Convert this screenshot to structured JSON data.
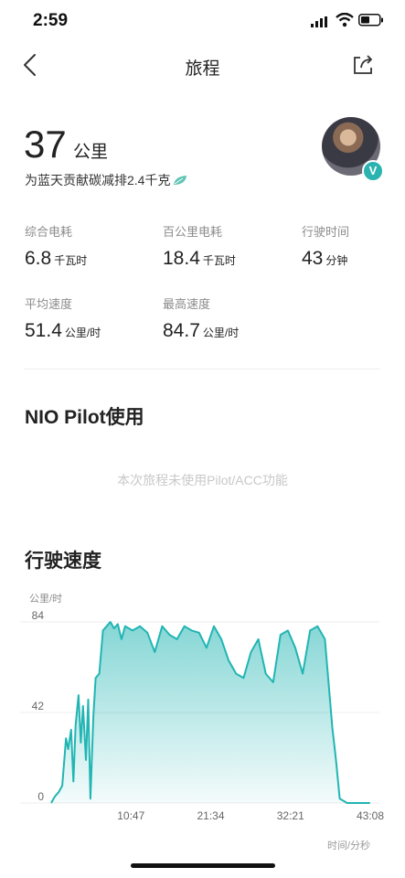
{
  "status_bar": {
    "time": "2:59"
  },
  "header": {
    "title": "旅程"
  },
  "summary": {
    "distance_value": "37",
    "distance_unit": "公里",
    "carbon_text": "为蓝天贡献碳减排2.4千克"
  },
  "stats": [
    {
      "label": "综合电耗",
      "value": "6.8",
      "unit": "千瓦时"
    },
    {
      "label": "百公里电耗",
      "value": "18.4",
      "unit": "千瓦时"
    },
    {
      "label": "行驶时间",
      "value": "43",
      "unit": "分钟"
    },
    {
      "label": "平均速度",
      "value": "51.4",
      "unit": "公里/时"
    },
    {
      "label": "最高速度",
      "value": "84.7",
      "unit": "公里/时"
    }
  ],
  "pilot": {
    "title": "NIO Pilot使用",
    "note": "本次旅程未使用Pilot/ACC功能"
  },
  "speed_section": {
    "title": "行驶速度"
  },
  "colors": {
    "accent": "#21b5b3",
    "badge": "#2bb3b0",
    "leaf": "#5ec4b4"
  },
  "icons": [
    "back-icon",
    "share-icon",
    "leaf-icon",
    "verified-badge-icon"
  ],
  "chart_data": {
    "type": "area",
    "title": "行驶速度",
    "ylabel": "公里/时",
    "xlabel": "时间/分秒",
    "ylim": [
      0,
      84
    ],
    "yticks": [
      "0",
      "42",
      "84"
    ],
    "xticks": [
      "10:47",
      "21:34",
      "32:21",
      "43:08"
    ],
    "x_minutes": [
      0,
      0.5,
      1,
      1.5,
      2,
      2.3,
      2.7,
      3,
      3.3,
      3.7,
      4,
      4.3,
      4.7,
      5,
      5.3,
      5.7,
      6,
      6.5,
      7,
      7.5,
      8,
      8.5,
      9,
      9.5,
      10,
      11,
      12,
      13,
      14,
      15,
      16,
      17,
      18,
      19,
      20,
      21,
      22,
      23,
      24,
      25,
      26,
      27,
      28,
      29,
      30,
      31,
      32,
      33,
      34,
      35,
      36,
      37,
      38,
      38.5,
      39,
      40,
      41,
      42,
      43.1
    ],
    "y_values": [
      0,
      3,
      5,
      8,
      30,
      25,
      34,
      10,
      36,
      50,
      28,
      45,
      20,
      48,
      2,
      40,
      58,
      60,
      80,
      82,
      84,
      81,
      83,
      76,
      82,
      80,
      82,
      79,
      70,
      82,
      78,
      76,
      82,
      80,
      79,
      72,
      82,
      76,
      66,
      60,
      58,
      70,
      76,
      60,
      56,
      78,
      80,
      72,
      60,
      80,
      82,
      76,
      35,
      20,
      2,
      0,
      0,
      0,
      0
    ]
  }
}
